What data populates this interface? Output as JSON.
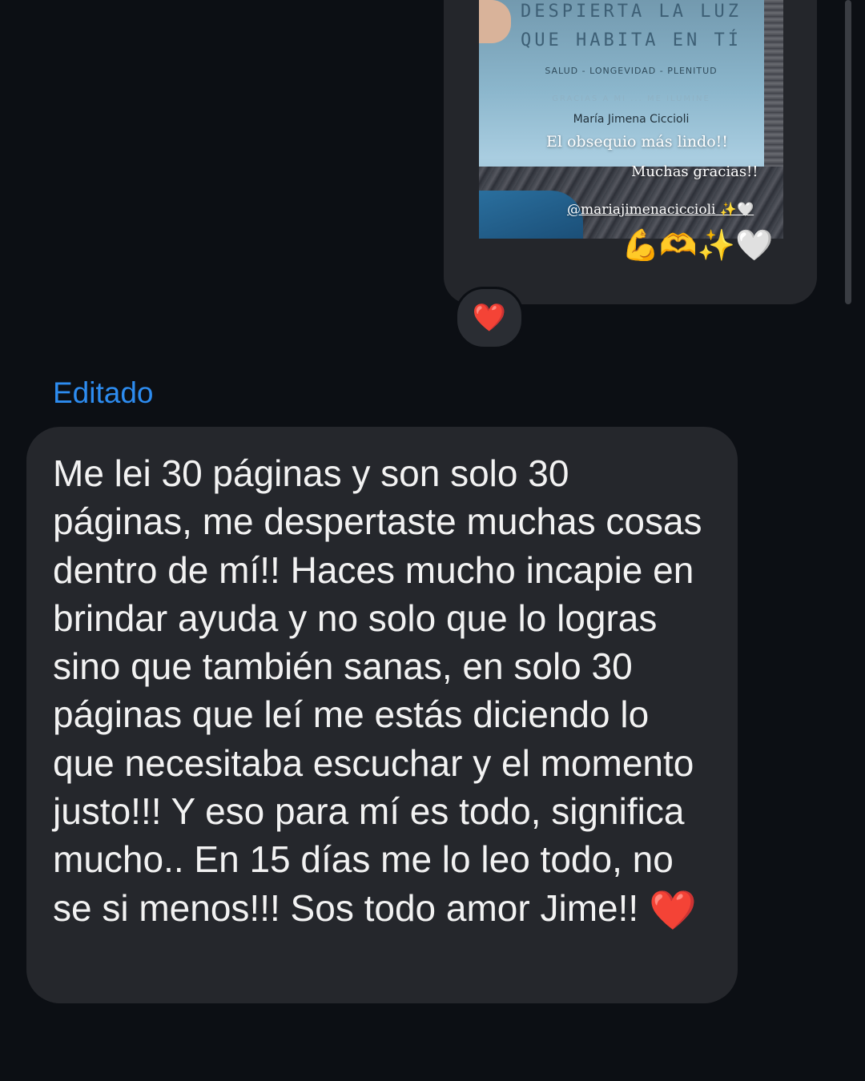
{
  "story_reply": {
    "book_title_line1": "DESPIERTA LA LUZ",
    "book_title_line2": "QUE HABITA EN TÍ",
    "book_subtitle": "SALUD - LONGEVIDAD - PLENITUD",
    "book_faint_line": "GRACIAS A MI ... ME ILUMINE",
    "book_author": "María Jimena Ciccioli",
    "overlay_line1": "El obsequio más lindo!!",
    "overlay_line2": "Muchas gracias!!",
    "overlay_handle": "@mariajimenaciccioli ✨🤍",
    "overlay_emojis": "💪🫶✨🤍"
  },
  "reaction": {
    "emoji": "❤️",
    "icon": "heart-icon"
  },
  "message": {
    "edited_label": "Editado",
    "text": "Me lei 30 páginas y son solo 30 páginas, me despertaste muchas cosas dentro de mí!! Haces mucho incapie en brindar ayuda y no solo que lo logras sino que también sanas, en solo 30 páginas que leí me estás diciendo lo que necesitaba escuchar y el momento justo!!! Y eso para mí es todo, significa mucho.. En 15 días me lo leo todo, no se si menos!!! Sos todo amor Jime!!",
    "trailing_emoji": "❤️"
  },
  "colors": {
    "background": "#0c0f14",
    "bubble": "#25272c",
    "accent_blue": "#2d8cf0",
    "heart_red": "#e5262e",
    "text": "#f2f2f2"
  }
}
